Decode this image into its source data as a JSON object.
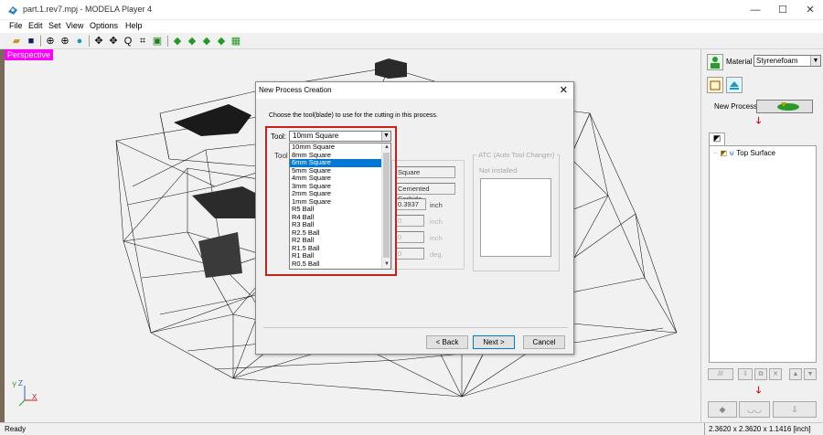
{
  "window": {
    "title": "part.1.rev7.mpj - MODELA Player 4",
    "minimize": "—",
    "maximize": "☐",
    "close": "✕"
  },
  "menu": [
    "File",
    "Edit",
    "Set",
    "View",
    "Options",
    "Help"
  ],
  "toolbar_icons": [
    "open-folder-icon",
    "save-icon",
    "view-target-icon",
    "view-rotate-icon",
    "globe-icon",
    "move-icon",
    "pan-icon",
    "zoom-icon",
    "zoom-fit-icon",
    "zoom-window-icon",
    "view-front-icon",
    "view-side-icon",
    "view-top-icon",
    "view-iso-icon",
    "grid-view-icon"
  ],
  "viewport": {
    "mode_label": "Perspective",
    "axis_labels": {
      "y": "Y",
      "z": "Z",
      "x": "X"
    }
  },
  "right_panel": {
    "material_label": "Material",
    "material_value": "Styrenefoam",
    "new_process_label": "New Process",
    "tree_item": "Top Surface"
  },
  "status": {
    "left": "Ready",
    "dimensions": "2.3620 x 2.3620 x 1.1416 [inch]"
  },
  "dialog": {
    "title": "New Process Creation",
    "close": "✕",
    "instruction": "Choose the tool(blade) to use for the cutting in this process.",
    "tool_label": "Tool:",
    "tool_selected": "10mm Square",
    "tool_options": [
      "10mm Square",
      "8mm Square",
      "6mm Square",
      "5mm Square",
      "4mm Square",
      "3mm Square",
      "2mm Square",
      "1mm Square",
      "R5 Ball",
      "R4 Ball",
      "R3 Ball",
      "R2.5 Ball",
      "R2 Ball",
      "R1.5 Ball",
      "R1 Ball",
      "R0.5 Ball"
    ],
    "highlighted_option": "6mm Square",
    "tool_info_label": "Tool",
    "shape_value": "Square",
    "material_value": "Cemented Carbide",
    "diameter_value": "0.3937",
    "diameter_unit": "inch",
    "field_gray_values": [
      "0",
      "0",
      "0"
    ],
    "field_gray_units": [
      "inch",
      "inch",
      "deg."
    ],
    "atc_title": "ATC (Auto Tool Changer)",
    "atc_status": "Not installed",
    "back_button": "< Back",
    "next_button": "Next >",
    "cancel_button": "Cancel"
  }
}
